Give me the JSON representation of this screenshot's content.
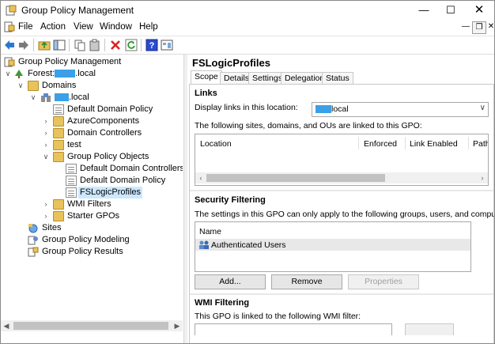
{
  "window": {
    "title": "Group Policy Management"
  },
  "menu": [
    "File",
    "Action",
    "View",
    "Window",
    "Help"
  ],
  "tree": {
    "root": "Group Policy Management",
    "forest_prefix": "Forest:",
    "forest_suffix": ".local",
    "domains": "Domains",
    "domain_suffix": ".local",
    "items": {
      "default_domain_policy": "Default Domain Policy",
      "azure_components": "AzureComponents",
      "domain_controllers": "Domain Controllers",
      "test": "test",
      "gpo_folder": "Group Policy Objects",
      "gpo_ddcp": "Default Domain Controllers P",
      "gpo_ddp": "Default Domain Policy",
      "gpo_fslogix": "FSLogicProfiles",
      "wmi_filters": "WMI Filters",
      "starter_gpos": "Starter GPOs",
      "sites": "Sites",
      "modeling": "Group Policy Modeling",
      "results": "Group Policy Results"
    }
  },
  "details": {
    "title": "FSLogicProfiles",
    "tabs": [
      "Scope",
      "Details",
      "Settings",
      "Delegation",
      "Status"
    ],
    "links": {
      "heading": "Links",
      "display_label": "Display links in this location:",
      "location_suffix": "local",
      "description": "The following sites, domains, and OUs are linked to this GPO:",
      "columns": [
        "Location",
        "Enforced",
        "Link Enabled",
        "Path"
      ]
    },
    "security": {
      "heading": "Security Filtering",
      "description": "The settings in this GPO can only apply to the following groups, users, and computers:",
      "column": "Name",
      "entries": [
        "Authenticated Users"
      ],
      "buttons": {
        "add": "Add...",
        "remove": "Remove",
        "properties": "Properties"
      }
    },
    "wmi": {
      "heading": "WMI Filtering",
      "description": "This GPO is linked to the following WMI filter:"
    }
  },
  "colors": {
    "selection": "#cce8ff",
    "redaction": "#3aa0e8",
    "folder": "#e8c25a"
  }
}
